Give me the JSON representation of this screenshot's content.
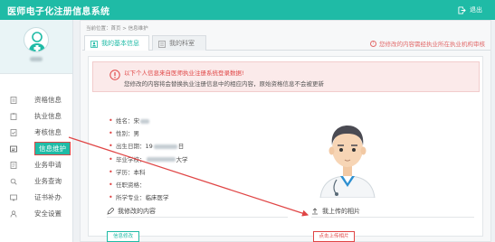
{
  "header": {
    "title": "医师电子化注册信息系统",
    "logout_label": "退出"
  },
  "sidebar": {
    "items": [
      {
        "label": "资格信息",
        "icon": "document-icon"
      },
      {
        "label": "执业信息",
        "icon": "clipboard-icon"
      },
      {
        "label": "考核信息",
        "icon": "checklist-icon"
      },
      {
        "label": "信息维护",
        "icon": "edit-icon",
        "active": true
      },
      {
        "label": "业务申请",
        "icon": "form-icon"
      },
      {
        "label": "业务查询",
        "icon": "search-icon"
      },
      {
        "label": "证书补办",
        "icon": "certificate-icon"
      },
      {
        "label": "安全设置",
        "icon": "user-lock-icon"
      }
    ]
  },
  "breadcrumb": "当前位置：首页 > 信息维护",
  "tabs": [
    {
      "label": "我的基本信息",
      "active": true
    },
    {
      "label": "我的科室",
      "active": false
    }
  ],
  "top_notice": "您修改的内容需经执业所在执业机构审核",
  "alert": {
    "line1": "以下个人信息来自医师执业注册系统登录数据!",
    "line2": "您修改的内容将会替换执业注册信息中的相应内容，原始资格信息不会被更新"
  },
  "fields": {
    "name_label": "姓名：",
    "name_value": "宋",
    "gender_label": "性别：",
    "gender_value": "男",
    "birth_label": "出生日期：",
    "birth_value_prefix": "19",
    "birth_value_suffix": "日",
    "school_label": "毕业学校：",
    "school_value_suffix": "大学",
    "degree_label": "学历：",
    "degree_value": "本科",
    "title_label": "任职资格：",
    "title_value": "",
    "major_label": "所学专业：",
    "major_value": "临床医学"
  },
  "sections": {
    "left_title": "我修改的内容",
    "right_title": "我上传的相片",
    "left_button": "信息修改",
    "right_button": "点击上传相片"
  },
  "colors": {
    "brand": "#1fbba6",
    "alert_red": "#e04545"
  }
}
